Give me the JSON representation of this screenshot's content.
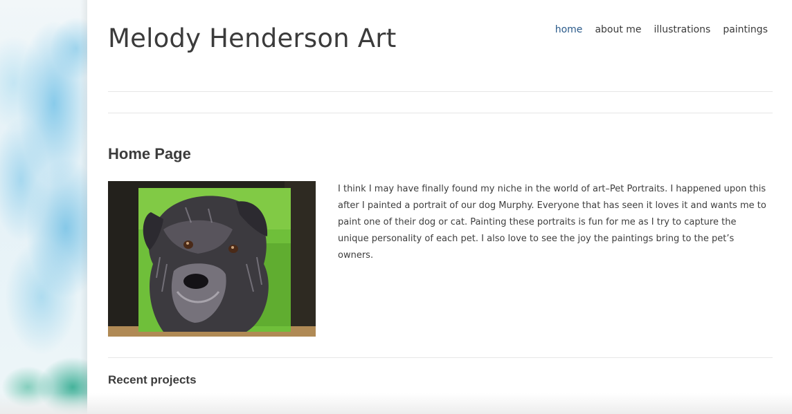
{
  "site": {
    "title": "Melody Henderson Art"
  },
  "nav": {
    "items": [
      {
        "label": "home",
        "active": true
      },
      {
        "label": "about me",
        "active": false
      },
      {
        "label": "illustrations",
        "active": false
      },
      {
        "label": "paintings",
        "active": false
      }
    ]
  },
  "page": {
    "title": "Home Page",
    "body": "I think I may have finally found my niche in the world of art–Pet Portraits.  I happened upon this after I painted a portrait of our dog Murphy.  Everyone that has seen it loves it and wants me to paint one of their dog or cat.  Painting these portraits is fun for me as I try to capture the unique personality of each pet.  I also love to see the joy the paintings bring to the pet’s owners.",
    "image": "dog-portrait-painting"
  },
  "recent": {
    "heading": "Recent projects"
  },
  "colors": {
    "nav_active": "#2a5a8a",
    "text": "#3a3a3a",
    "painting_green": "#6fbf3a"
  }
}
